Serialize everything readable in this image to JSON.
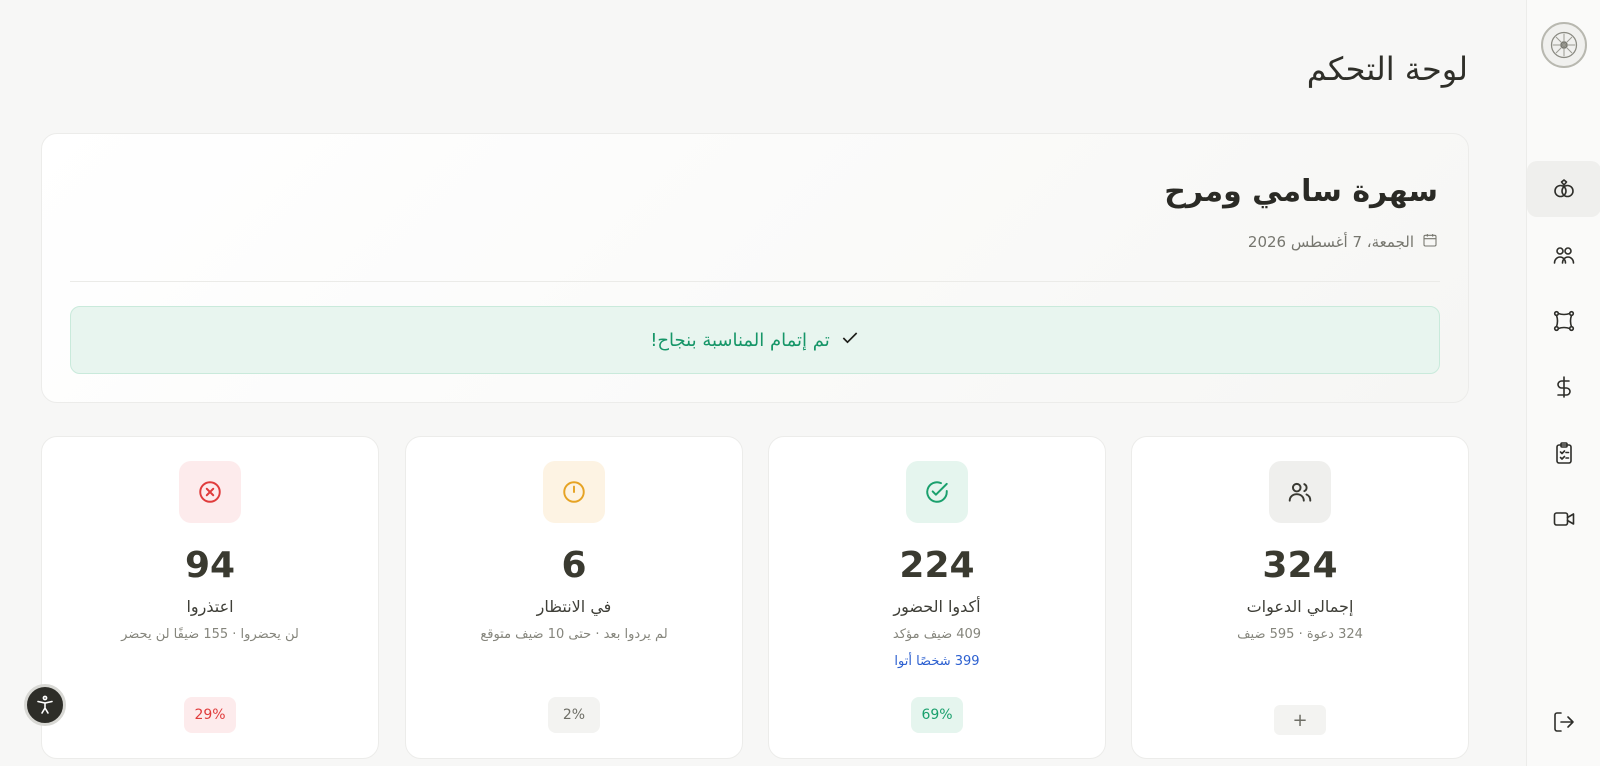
{
  "page": {
    "title": "لوحة التحكم"
  },
  "event": {
    "name": "سهرة سامي ومرح",
    "date": "الجمعة، 7 أغسطس 2026",
    "success_message": "تم إتمام المناسبة بنجاح!"
  },
  "stats": {
    "total": {
      "value": "324",
      "label": "إجمالي الدعوات",
      "sub": "324 دعوة · 595 ضيف",
      "add_label": "+",
      "icon": "users-icon",
      "color": "#555550"
    },
    "confirmed": {
      "value": "224",
      "label": "أكدوا الحضور",
      "sub": "409 ضيف مؤكد",
      "link": "399 شخصًا أتوا",
      "badge": "69%",
      "icon": "check-circle-icon",
      "color": "#1aa06d"
    },
    "pending": {
      "value": "6",
      "label": "في الانتظار",
      "sub": "لم يردوا بعد · حتى 10 ضيف متوقع",
      "badge": "2%",
      "icon": "clock-icon",
      "color": "#e6a324"
    },
    "declined": {
      "value": "94",
      "label": "اعتذروا",
      "sub": "لن يحضروا · 155 ضيفًا لن يحضر",
      "badge": "29%",
      "icon": "x-circle-icon",
      "color": "#e03c3c"
    }
  },
  "sidebar": {
    "items": [
      "rings-icon",
      "guests-icon",
      "frame-icon",
      "dollar-icon",
      "clipboard-icon",
      "video-icon"
    ],
    "active": "rings-icon",
    "logout": "logout-icon"
  }
}
